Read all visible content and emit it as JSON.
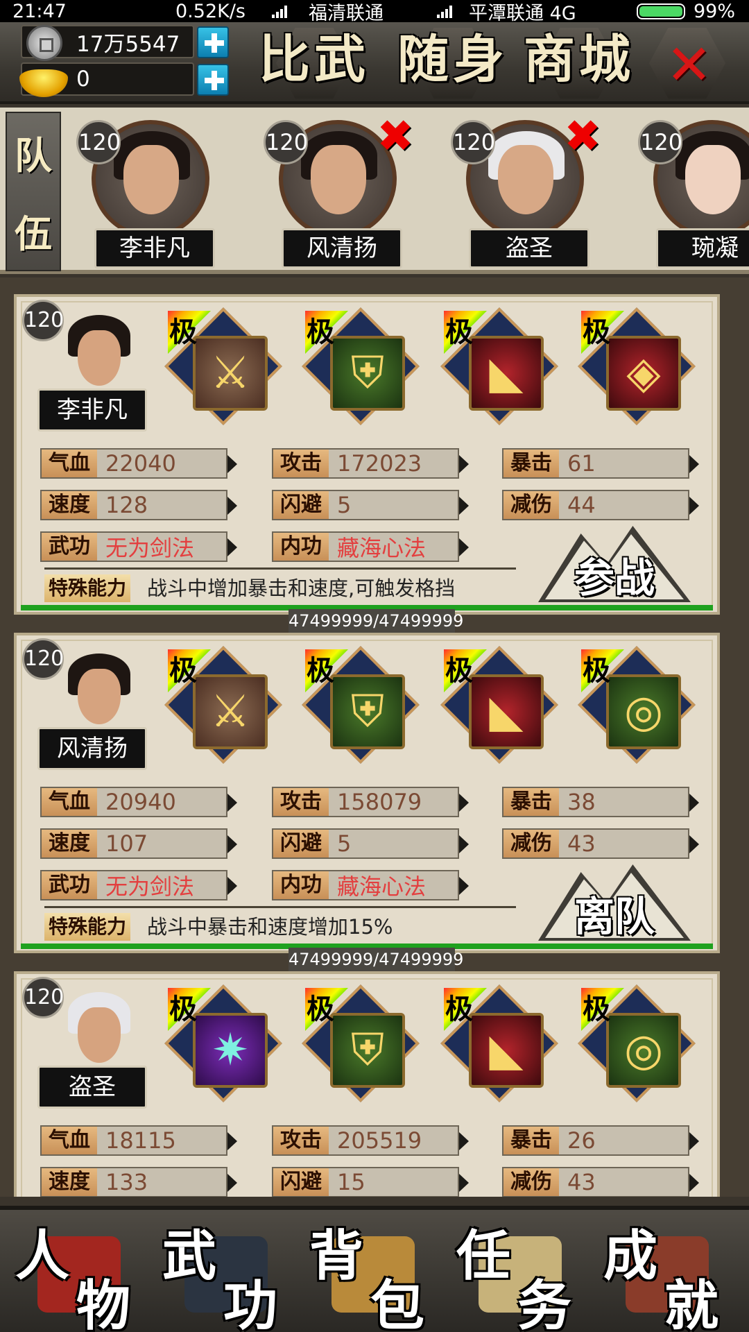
{
  "status_bar": {
    "time": "21:47",
    "speed": "0.52K/s",
    "carrier1": "福清联通",
    "carrier2": "平潭联通 4G",
    "battery": "99%"
  },
  "top": {
    "silver": "17万5547",
    "gold": "0",
    "buttons": [
      "比武",
      "随身",
      "商城"
    ],
    "close_icon": "close-x-icon"
  },
  "team": {
    "label_top": "队",
    "label_bottom": "伍",
    "members": [
      {
        "level": "120",
        "name": "李非凡",
        "removable": false
      },
      {
        "level": "120",
        "name": "风清扬",
        "removable": true
      },
      {
        "level": "120",
        "name": "盗圣",
        "removable": true
      },
      {
        "level": "120",
        "name": "琬凝"
      }
    ]
  },
  "cards": [
    {
      "level": "120",
      "name": "李非凡",
      "equip_tag": "极",
      "stats": {
        "hp_label": "气血",
        "hp": "22040",
        "atk_label": "攻击",
        "atk": "172023",
        "crit_label": "暴击",
        "crit": "61",
        "spd_label": "速度",
        "spd": "128",
        "dodge_label": "闪避",
        "dodge": "5",
        "dr_label": "减伤",
        "dr": "44",
        "skill_label": "武功",
        "skill": "无为剑法",
        "inner_label": "内功",
        "inner": "藏海心法"
      },
      "special_label": "特殊能力",
      "special": "战斗中增加暴击和速度,可触发格挡",
      "action": "参战",
      "hp_text": "47499999/47499999",
      "hp_fill": 1.0
    },
    {
      "level": "120",
      "name": "风清扬",
      "equip_tag": "极",
      "stats": {
        "hp_label": "气血",
        "hp": "20940",
        "atk_label": "攻击",
        "atk": "158079",
        "crit_label": "暴击",
        "crit": "38",
        "spd_label": "速度",
        "spd": "107",
        "dodge_label": "闪避",
        "dodge": "5",
        "dr_label": "减伤",
        "dr": "43",
        "skill_label": "武功",
        "skill": "无为剑法",
        "inner_label": "内功",
        "inner": "藏海心法"
      },
      "special_label": "特殊能力",
      "special": "战斗中暴击和速度增加15%",
      "action": "离队",
      "hp_text": "47499999/47499999",
      "hp_fill": 1.0
    },
    {
      "level": "120",
      "name": "盗圣",
      "equip_tag": "极",
      "stats": {
        "hp_label": "气血",
        "hp": "18115",
        "atk_label": "攻击",
        "atk": "205519",
        "crit_label": "暴击",
        "crit": "26",
        "spd_label": "速度",
        "spd": "133",
        "dodge_label": "闪避",
        "dodge": "15",
        "dr_label": "减伤",
        "dr": "43"
      }
    }
  ],
  "bottom_nav": [
    {
      "c1": "人",
      "c2": "物",
      "color": "#a3261f"
    },
    {
      "c1": "武",
      "c2": "功",
      "color": "#2b3441"
    },
    {
      "c1": "背",
      "c2": "包",
      "color": "#b98a3a"
    },
    {
      "c1": "任",
      "c2": "务",
      "color": "#c7b27a"
    },
    {
      "c1": "成",
      "c2": "就",
      "color": "#8a3c2a"
    }
  ]
}
